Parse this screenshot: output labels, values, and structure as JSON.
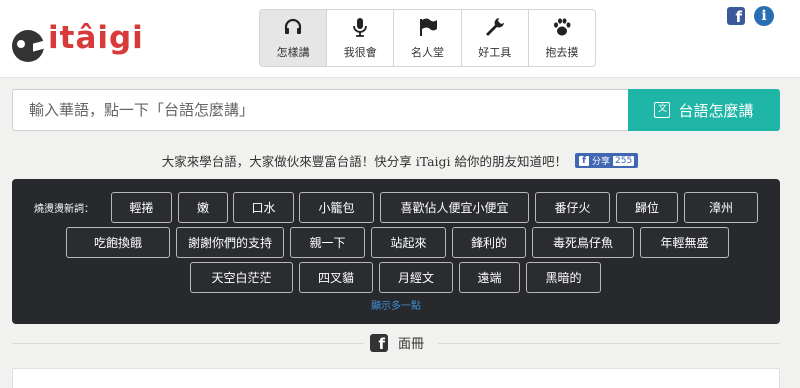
{
  "header": {
    "logo_text": "itâigi",
    "nav": [
      {
        "label": "怎樣講",
        "icon": "headphones-icon",
        "active": true
      },
      {
        "label": "我很會",
        "icon": "microphone-icon",
        "active": false
      },
      {
        "label": "名人堂",
        "icon": "flag-icon",
        "active": false
      },
      {
        "label": "好工具",
        "icon": "wrench-icon",
        "active": false
      },
      {
        "label": "抱去摸",
        "icon": "paw-icon",
        "active": false
      }
    ],
    "facebook_icon": "facebook-icon",
    "info_icon": "info-icon"
  },
  "search": {
    "placeholder": "輸入華語，點一下「台語怎麼講」",
    "button_label": "台語怎麼講",
    "button_icon": "translate-icon"
  },
  "share": {
    "text": "大家來學台語，大家做伙來豐富台語！快分享 iTaigi 給你的朋友知道吧！",
    "button_label": "分享",
    "count": "255"
  },
  "hot_words": {
    "label": "燒燙燙新詞：",
    "tags": [
      "輕捲",
      "嫩",
      "口水",
      "小籠包",
      "喜歡佔人便宜小便宜",
      "番仔火",
      "歸位",
      "漳州",
      "吃飽換餓",
      "謝謝你們的支持",
      "親一下",
      "站起來",
      "鋒利的",
      "毒死鳥仔魚",
      "年輕無盛",
      "天空白茫茫",
      "四叉貓",
      "月經文",
      "遠端",
      "黑暗的"
    ],
    "more_link": "顯示多一點"
  },
  "facebook_section": {
    "label": "面冊",
    "icon": "facebook-icon"
  },
  "colors": {
    "accent": "#1fb6a8",
    "logo_red": "#d83a3a",
    "panel_bg": "#27292d",
    "link_blue": "#3f8fd6",
    "facebook_blue": "#3b5998"
  }
}
